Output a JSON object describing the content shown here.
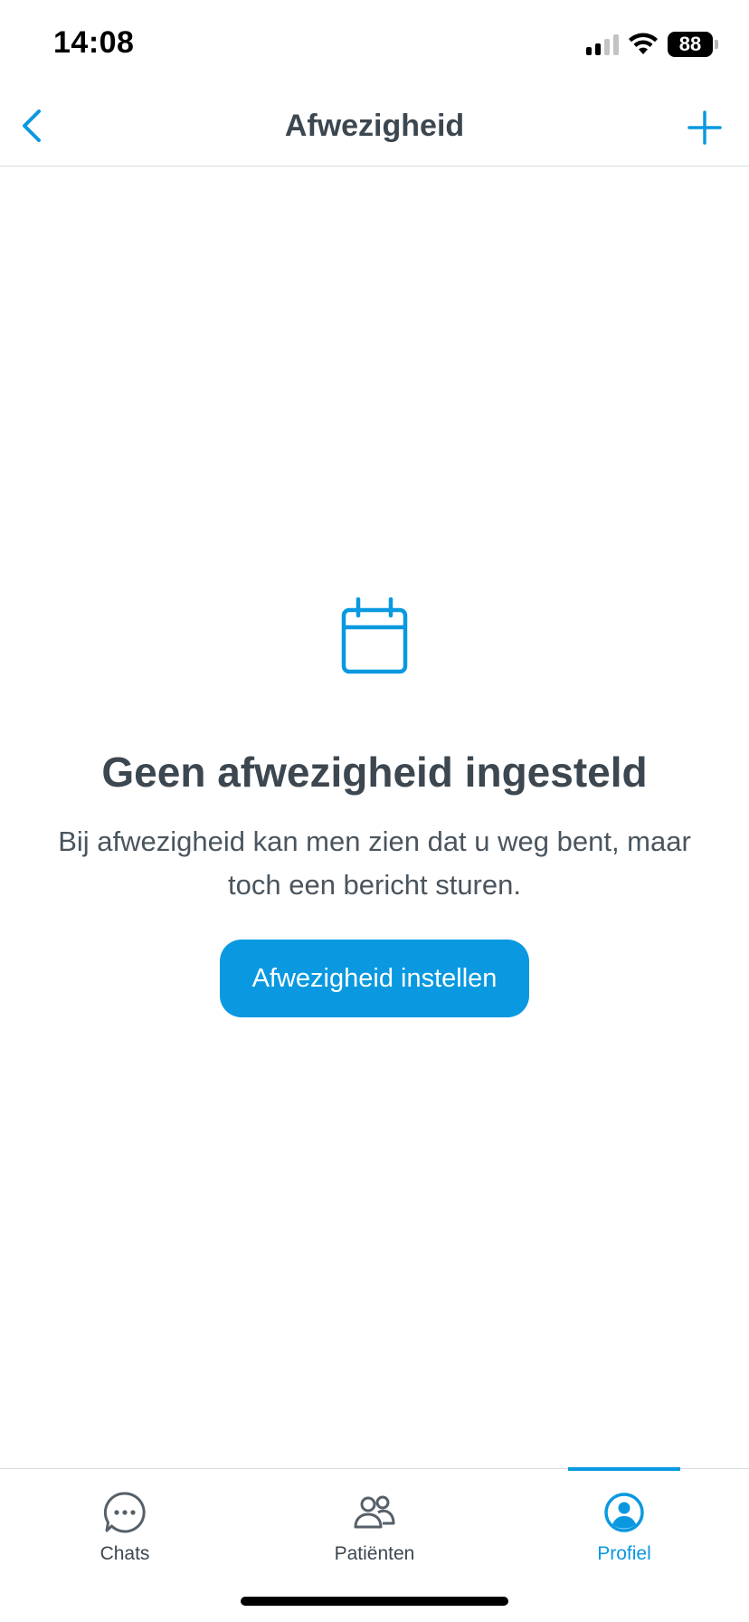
{
  "status_bar": {
    "time": "14:08",
    "battery": "88",
    "icons": [
      "cellular-signal-icon",
      "wifi-icon",
      "battery-icon"
    ]
  },
  "nav": {
    "title": "Afwezigheid",
    "back_icon": "chevron-left-icon",
    "add_icon": "plus-icon"
  },
  "empty_state": {
    "icon": "calendar-icon",
    "title": "Geen afwezigheid ingesteld",
    "description": "Bij afwezigheid kan men zien dat u weg bent, maar toch een bericht sturen.",
    "button_label": "Afwezigheid instellen"
  },
  "tabs": [
    {
      "label": "Chats",
      "icon": "chat-bubble-icon",
      "active": false
    },
    {
      "label": "Patiënten",
      "icon": "people-icon",
      "active": false
    },
    {
      "label": "Profiel",
      "icon": "user-circle-icon",
      "active": true
    }
  ],
  "colors": {
    "accent": "#0a99e0",
    "text_dark": "#3c4750",
    "divider": "#d9dcdf"
  }
}
